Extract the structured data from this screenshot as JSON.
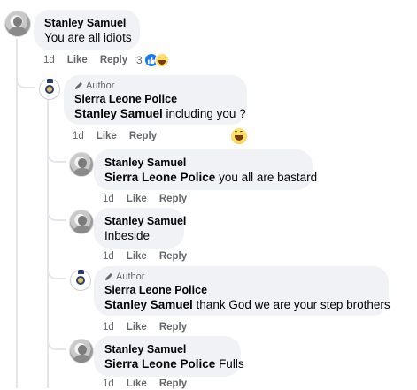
{
  "comments": [
    {
      "name": "Stanley Samuel",
      "text": "You are all idiots",
      "time": "1d",
      "like": "Like",
      "reply": "Reply",
      "reaction_count": "3"
    },
    {
      "author_label": "Author",
      "name": "Sierra Leone Police",
      "mention": "Stanley Samuel",
      "text": " including you ?",
      "time": "1d",
      "like": "Like",
      "reply": "Reply"
    },
    {
      "name": "Stanley Samuel",
      "mention": "Sierra Leone Police",
      "text": " you all are bastard",
      "time": "1d",
      "like": "Like",
      "reply": "Reply"
    },
    {
      "name": "Stanley Samuel",
      "text": "Inbeside",
      "time": "1d",
      "like": "Like",
      "reply": "Reply"
    },
    {
      "author_label": "Author",
      "name": "Sierra Leone Police",
      "mention": "Stanley Samuel",
      "text": " thank God we are your step brothers",
      "time": "1d",
      "like": "Like",
      "reply": "Reply"
    },
    {
      "name": "Stanley Samuel",
      "mention": "Sierra Leone Police",
      "text": " Fulls",
      "time": "1d",
      "like": "Like",
      "reply": "Reply"
    }
  ],
  "icons": {
    "like": "thumbs-up-icon",
    "haha": "haha-emoji-icon",
    "author": "pencil-icon"
  },
  "colors": {
    "bubble": "#f0f2f5",
    "like_blue": "#1877f2",
    "meta_gray": "#65676b",
    "thread_line": "#e4e6eb"
  }
}
